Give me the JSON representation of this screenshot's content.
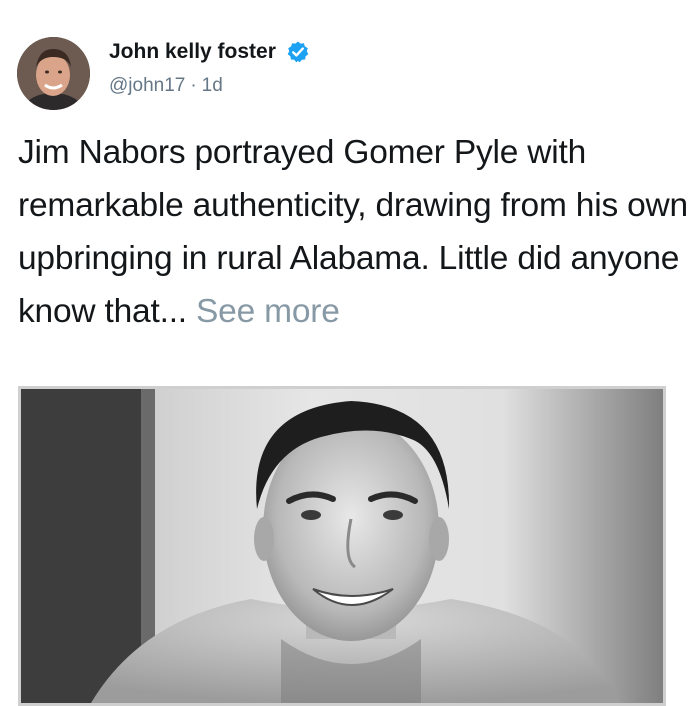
{
  "tweet": {
    "author_name": "John kelly foster",
    "verified_icon": "verified-badge-icon",
    "handle": "@john17",
    "separator": "·",
    "timestamp": "1d",
    "text": "Jim Nabors portrayed Gomer Pyle with remarkable authenticity, drawing from his own upbringing in rural Alabama. Little did anyone know that...",
    "see_more_label": "See more"
  },
  "colors": {
    "text": "#14171a",
    "muted": "#657786",
    "see_more": "#8899a6",
    "verified": "#1da1f2"
  }
}
